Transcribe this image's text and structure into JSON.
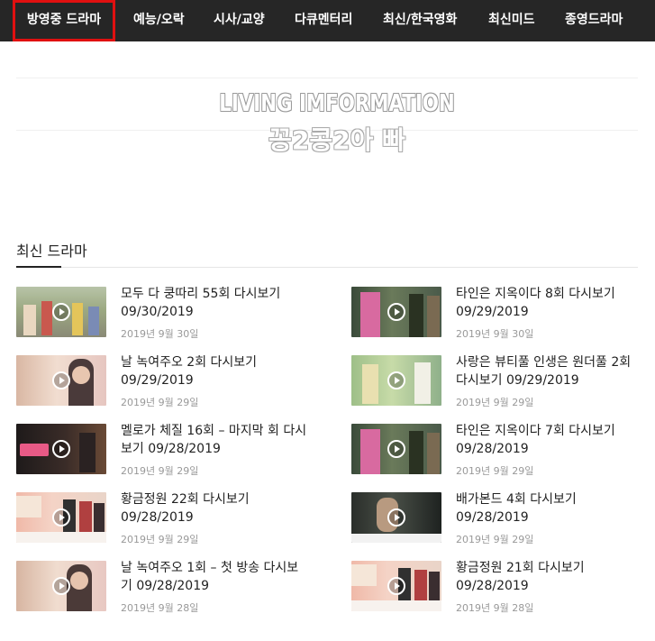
{
  "nav": {
    "items": [
      {
        "label": "방영중 드라마",
        "active": true
      },
      {
        "label": "예능/오락",
        "active": false
      },
      {
        "label": "시사/교양",
        "active": false
      },
      {
        "label": "다큐멘터리",
        "active": false
      },
      {
        "label": "최신/한국영화",
        "active": false
      },
      {
        "label": "최신미드",
        "active": false
      },
      {
        "label": "종영드라마",
        "active": false
      }
    ]
  },
  "banner": {
    "title": "LIVING IMFORMATION",
    "subtitle": "꽁2콩2아 빠"
  },
  "section": {
    "title": "최신 드라마"
  },
  "posts": [
    {
      "title": "모두 다 쿵따리 55회 다시보기 09/30/2019",
      "date": "2019년 9월 30일"
    },
    {
      "title": "타인은 지옥이다 8회 다시보기 09/29/2019",
      "date": "2019년 9월 30일"
    },
    {
      "title": "날 녹여주오 2회 다시보기 09/29/2019",
      "date": "2019년 9월 29일"
    },
    {
      "title": "사랑은 뷰티풀 인생은 원더풀 2회 다시보기 09/29/2019",
      "date": "2019년 9월 29일"
    },
    {
      "title": "멜로가 체질 16회 – 마지막 회 다시보기 09/28/2019",
      "date": "2019년 9월 29일"
    },
    {
      "title": "타인은 지옥이다 7회 다시보기 09/28/2019",
      "date": "2019년 9월 29일"
    },
    {
      "title": "황금정원 22회 다시보기 09/28/2019",
      "date": "2019년 9월 29일"
    },
    {
      "title": "배가본드 4회 다시보기 09/28/2019",
      "date": "2019년 9월 29일"
    },
    {
      "title": "날 녹여주오 1회 – 첫 방송 다시보기 09/28/2019",
      "date": "2019년 9월 28일"
    },
    {
      "title": "황금정원 21회 다시보기 09/28/2019",
      "date": "2019년 9월 28일"
    }
  ],
  "colors": {
    "nav_bg": "#262626",
    "active_outline": "#e01010",
    "date_text": "#999999"
  }
}
